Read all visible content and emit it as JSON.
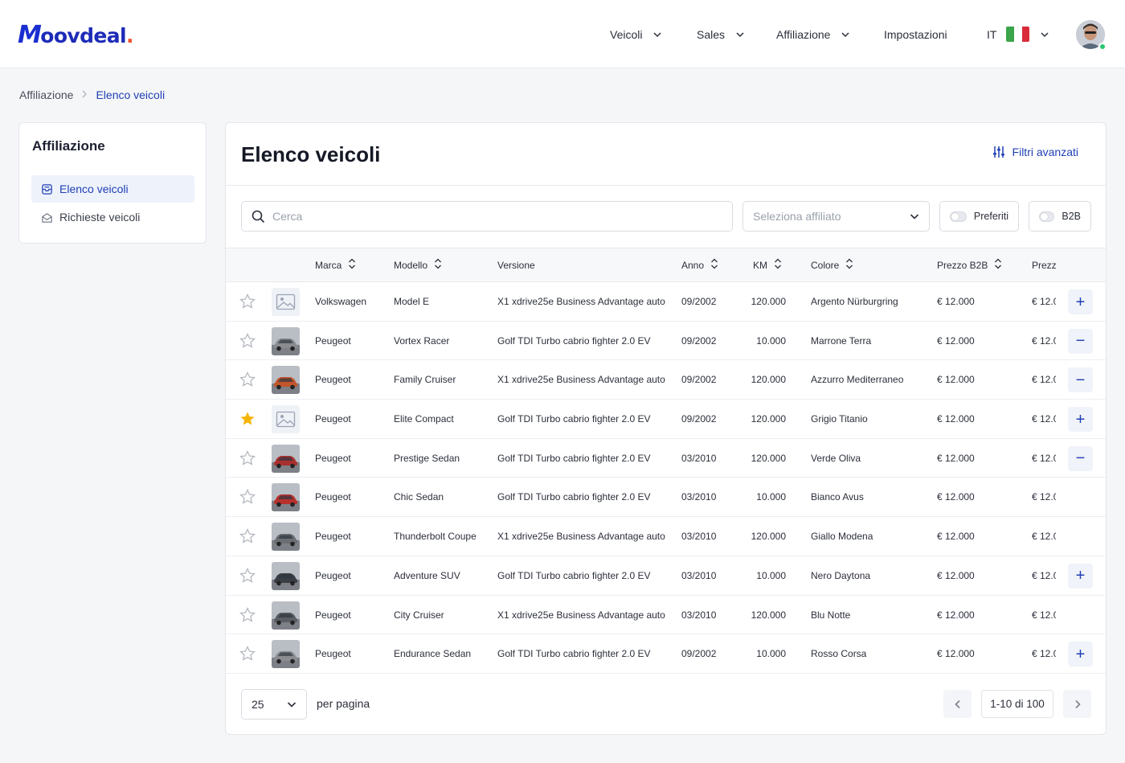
{
  "brand": {
    "logo_text": "oovdeal",
    "logo_m": "M",
    "logo_dot": "."
  },
  "nav": {
    "items": [
      {
        "label": "Veicoli"
      },
      {
        "label": "Sales"
      },
      {
        "label": "Affiliazione"
      },
      {
        "label": "Impostazioni"
      }
    ],
    "language": "IT"
  },
  "breadcrumb": {
    "parent": "Affiliazione",
    "current": "Elenco veicoli"
  },
  "sidebar": {
    "title": "Affiliazione",
    "items": [
      {
        "label": "Elenco veicoli",
        "active": true
      },
      {
        "label": "Richieste veicoli",
        "active": false
      }
    ]
  },
  "main": {
    "title": "Elenco veicoli",
    "advanced_filters": "Filtri avanzati",
    "search_placeholder": "Cerca",
    "affiliate_placeholder": "Seleziona affiliato",
    "toggle_favorites": "Preferiti",
    "toggle_b2b": "B2B"
  },
  "table": {
    "columns": {
      "brand": "Marca",
      "model": "Modello",
      "version": "Versione",
      "year": "Anno",
      "km": "KM",
      "color": "Colore",
      "price_b2b": "Prezzo B2B",
      "price": "Prezz"
    },
    "rows": [
      {
        "favorite": false,
        "image": "placeholder",
        "brand": "Volkswagen",
        "model": "Model E",
        "version": "X1 xdrive25e Business Advantage auto",
        "year": "09/2002",
        "km": "120.000",
        "color": "Argento Nürburgring",
        "price_b2b": "€ 12.000",
        "price": "€ 12.0",
        "action": "+"
      },
      {
        "favorite": false,
        "image": "photo",
        "brand": "Peugeot",
        "model": "Vortex Racer",
        "version": "Golf TDI Turbo cabrio fighter 2.0 EV",
        "year": "09/2002",
        "km": "10.000",
        "color": "Marrone Terra",
        "price_b2b": "€ 12.000",
        "price": "€ 12.0",
        "action": "−"
      },
      {
        "favorite": false,
        "image": "photo",
        "brand": "Peugeot",
        "model": "Family Cruiser",
        "version": "X1 xdrive25e Business Advantage auto",
        "year": "09/2002",
        "km": "120.000",
        "color": "Azzurro Mediterraneo",
        "price_b2b": "€ 12.000",
        "price": "€ 12.0",
        "action": "−"
      },
      {
        "favorite": true,
        "image": "placeholder",
        "brand": "Peugeot",
        "model": "Elite Compact",
        "version": "Golf TDI Turbo cabrio fighter 2.0 EV",
        "year": "09/2002",
        "km": "120.000",
        "color": "Grigio Titanio",
        "price_b2b": "€ 12.000",
        "price": "€ 12.0",
        "action": "+"
      },
      {
        "favorite": false,
        "image": "photo",
        "brand": "Peugeot",
        "model": "Prestige Sedan",
        "version": "Golf TDI Turbo cabrio fighter 2.0 EV",
        "year": "03/2010",
        "km": "120.000",
        "color": "Verde Oliva",
        "price_b2b": "€ 12.000",
        "price": "€ 12.0",
        "action": "−"
      },
      {
        "favorite": false,
        "image": "photo",
        "brand": "Peugeot",
        "model": "Chic Sedan",
        "version": "Golf TDI Turbo cabrio fighter 2.0 EV",
        "year": "03/2010",
        "km": "10.000",
        "color": "Bianco Avus",
        "price_b2b": "€ 12.000",
        "price": "€ 12.0",
        "action": ""
      },
      {
        "favorite": false,
        "image": "photo",
        "brand": "Peugeot",
        "model": "Thunderbolt Coupe",
        "version": "X1 xdrive25e Business Advantage auto",
        "year": "03/2010",
        "km": "120.000",
        "color": "Giallo Modena",
        "price_b2b": "€ 12.000",
        "price": "€ 12.0",
        "action": ""
      },
      {
        "favorite": false,
        "image": "photo",
        "brand": "Peugeot",
        "model": "Adventure SUV",
        "version": "Golf TDI Turbo cabrio fighter 2.0 EV",
        "year": "03/2010",
        "km": "10.000",
        "color": "Nero Daytona",
        "price_b2b": "€ 12.000",
        "price": "€ 12.0",
        "action": "+"
      },
      {
        "favorite": false,
        "image": "photo",
        "brand": "Peugeot",
        "model": "City Cruiser",
        "version": "X1 xdrive25e Business Advantage auto",
        "year": "03/2010",
        "km": "120.000",
        "color": "Blu Notte",
        "price_b2b": "€ 12.000",
        "price": "€ 12.0",
        "action": ""
      },
      {
        "favorite": false,
        "image": "photo",
        "brand": "Peugeot",
        "model": "Endurance Sedan",
        "version": "Golf TDI Turbo cabrio fighter 2.0 EV",
        "year": "09/2002",
        "km": "10.000",
        "color": "Rosso Corsa",
        "price_b2b": "€ 12.000",
        "price": "€ 12.0",
        "action": "+"
      }
    ]
  },
  "pagination": {
    "per_page": "25",
    "per_page_label": "per pagina",
    "info": "1-10 di 100"
  },
  "colors": {
    "accent": "#1f3fb5",
    "star_active": "#f5b50a",
    "online": "#28c76f",
    "logo_dot": "#f0502e"
  }
}
